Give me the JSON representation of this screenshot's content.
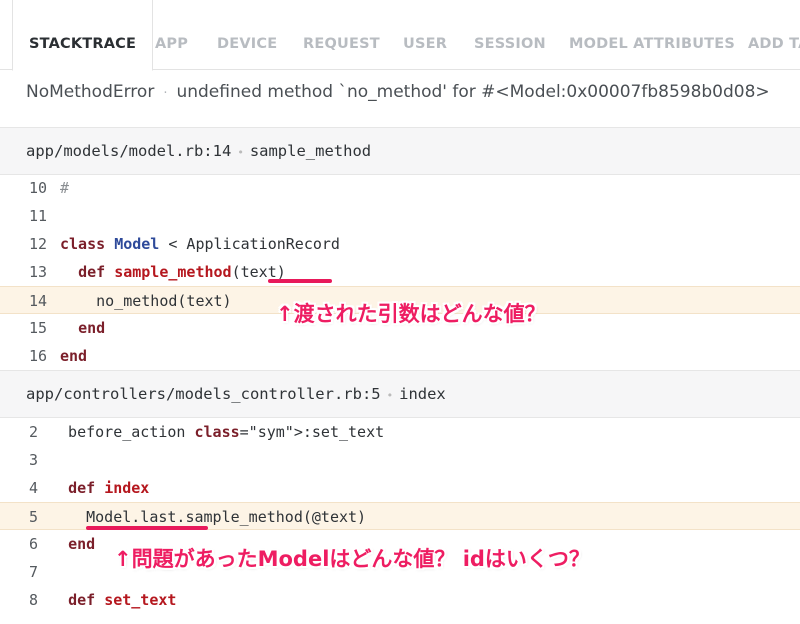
{
  "tabs": [
    {
      "label": "STACKTRACE",
      "active": true
    },
    {
      "label": "APP"
    },
    {
      "label": "DEVICE"
    },
    {
      "label": "REQUEST"
    },
    {
      "label": "USER"
    },
    {
      "label": "SESSION"
    },
    {
      "label": "MODEL ATTRIBUTES"
    },
    {
      "label": "ADD TA"
    }
  ],
  "error": {
    "class": "NoMethodError",
    "separator": "·",
    "message": "undefined method `no_method' for #<Model:0x00007fb8598b0d08>"
  },
  "frames": [
    {
      "file": "app/models/model.rb:14",
      "method": "sample_method",
      "lines": [
        {
          "no": "10",
          "text": "#"
        },
        {
          "no": "11",
          "text": ""
        },
        {
          "no": "12",
          "text": "class Model < ApplicationRecord"
        },
        {
          "no": "13",
          "text": "  def sample_method(text)"
        },
        {
          "no": "14",
          "text": "    no_method(text)",
          "highlighted": true
        },
        {
          "no": "15",
          "text": "  end"
        },
        {
          "no": "16",
          "text": "end"
        }
      ]
    },
    {
      "file": "app/controllers/models_controller.rb:5",
      "method": "index",
      "lines": [
        {
          "no": "2",
          "text": "  before_action :set_text"
        },
        {
          "no": "3",
          "text": ""
        },
        {
          "no": "4",
          "text": "  def index"
        },
        {
          "no": "5",
          "text": "    Model.last.sample_method(@text)",
          "highlighted": true
        },
        {
          "no": "6",
          "text": "  end"
        },
        {
          "no": "7",
          "text": ""
        },
        {
          "no": "8",
          "text": "  def set_text"
        }
      ]
    }
  ],
  "annotations": {
    "first": "↑渡された引数はどんな値？",
    "second": "↑問題があったModelはどんな値？ idはいくつ？"
  },
  "colors": {
    "annotation": "#ee1d62",
    "highlight_row": "#fdf4e6",
    "keyword": "#7b1f2a",
    "class_name": "#2e4a9a",
    "method_name": "#b5171e",
    "symbol": "#a13072"
  }
}
